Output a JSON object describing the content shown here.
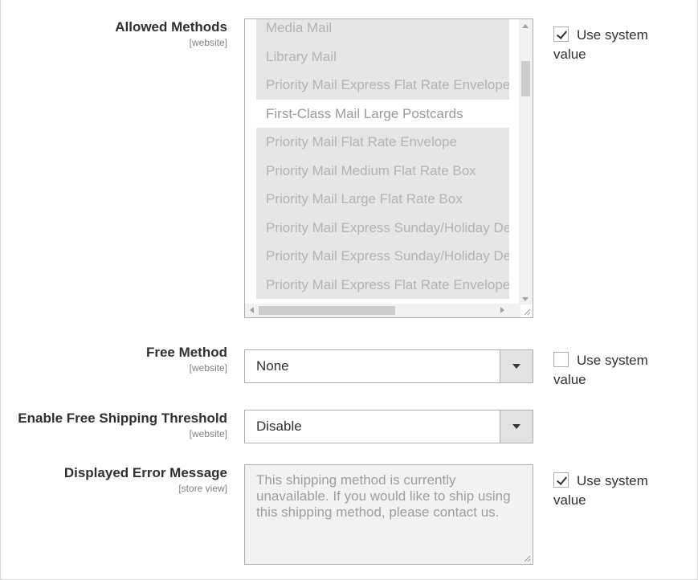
{
  "allowed_methods": {
    "label": "Allowed Methods",
    "scope": "[website]",
    "options": [
      {
        "label": "Media Mail",
        "selected": true
      },
      {
        "label": "Library Mail",
        "selected": true
      },
      {
        "label": "Priority Mail Express Flat Rate Envelope",
        "selected": true
      },
      {
        "label": "First-Class Mail Large Postcards",
        "selected": false
      },
      {
        "label": "Priority Mail Flat Rate Envelope",
        "selected": true
      },
      {
        "label": "Priority Mail Medium Flat Rate Box",
        "selected": true
      },
      {
        "label": "Priority Mail Large Flat Rate Box",
        "selected": true
      },
      {
        "label": "Priority Mail Express Sunday/Holiday Delivery",
        "selected": true
      },
      {
        "label": "Priority Mail Express Sunday/Holiday Delivery",
        "selected": true
      },
      {
        "label": "Priority Mail Express Flat Rate Envelope",
        "selected": true
      }
    ],
    "use_system_value": {
      "label": "Use system value",
      "checked": true
    }
  },
  "free_method": {
    "label": "Free Method",
    "scope": "[website]",
    "value": "None",
    "use_system_value": {
      "label": "Use system value",
      "checked": false
    }
  },
  "free_shipping_threshold": {
    "label": "Enable Free Shipping Threshold",
    "scope": "[website]",
    "value": "Disable"
  },
  "error_message": {
    "label": "Displayed Error Message",
    "scope": "[store view]",
    "value": "This shipping method is currently unavailable. If you would like to ship using this shipping method, please contact us.",
    "use_system_value": {
      "label": "Use system value",
      "checked": true
    }
  },
  "icons": {
    "checkbox_checked": "checkmark-icon",
    "select_arrow": "chevron-down-icon",
    "resize": "resize-grip-icon"
  },
  "colors": {
    "selected_option_bg": "#e6e6e6",
    "disabled_text": "#b3b3b3",
    "select_button_bg": "#e3e3e3",
    "textarea_bg": "#f2f2f2"
  }
}
